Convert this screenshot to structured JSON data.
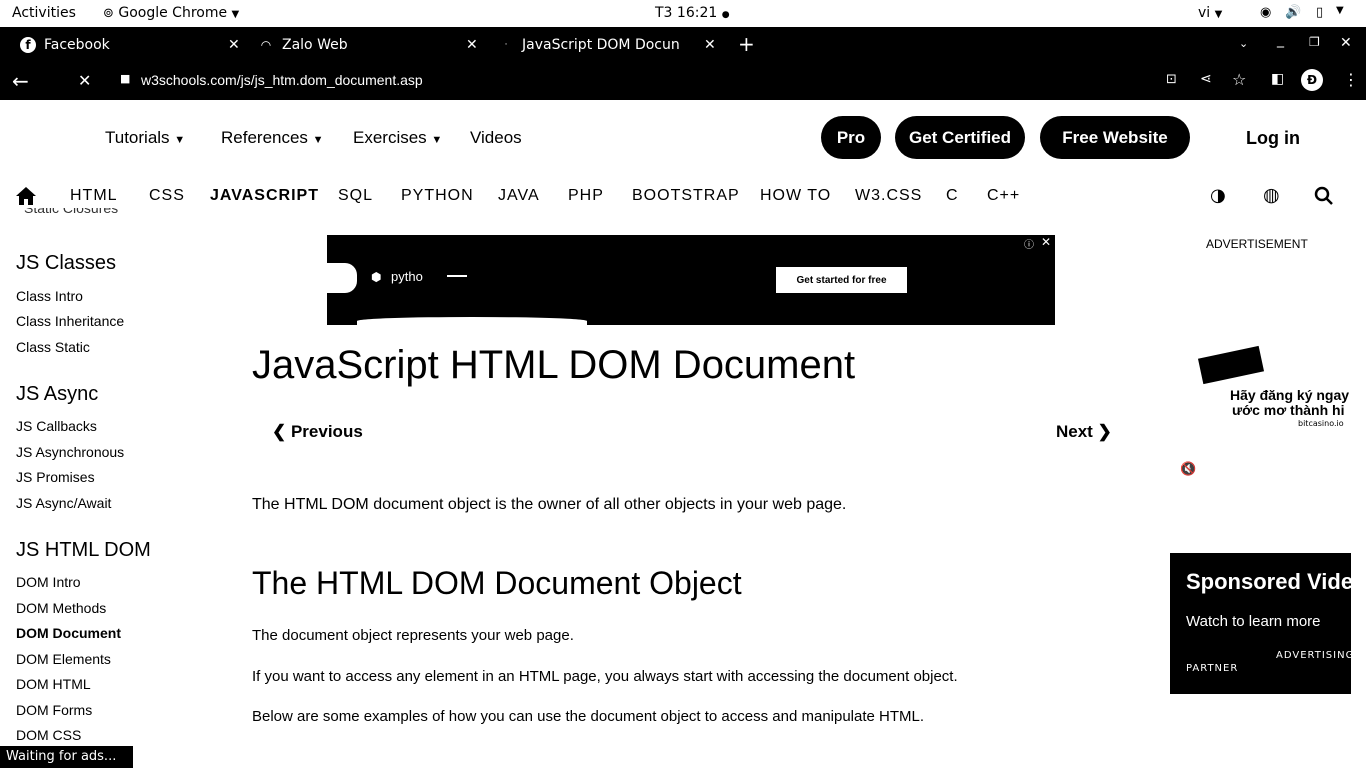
{
  "system_bar": {
    "activities": "Activities",
    "app": "Google Chrome",
    "clock": "T3 16:21",
    "lang": "vi"
  },
  "tabs": [
    {
      "label": "Facebook"
    },
    {
      "label": "Zalo Web"
    },
    {
      "label": "JavaScript DOM Docun"
    }
  ],
  "address": {
    "url": "w3schools.com/js/js_htm.dom_document.asp",
    "profile_initial": "Đ"
  },
  "top_nav": {
    "tutorials": "Tutorials",
    "references": "References",
    "exercises": "Exercises",
    "videos": "Videos",
    "pro": "Pro",
    "certified": "Get Certified",
    "free_website": "Free Website",
    "login": "Log in"
  },
  "sub_nav": [
    "HTML",
    "CSS",
    "JAVASCRIPT",
    "SQL",
    "PYTHON",
    "JAVA",
    "PHP",
    "BOOTSTRAP",
    "HOW TO",
    "W3.CSS",
    "C",
    "C++"
  ],
  "sidebar": {
    "cut_item": "Static Closures",
    "classes_heading": "JS Classes",
    "classes": [
      "Class Intro",
      "Class Inheritance",
      "Class Static"
    ],
    "async_heading": "JS Async",
    "async": [
      "JS Callbacks",
      "JS Asynchronous",
      "JS Promises",
      "JS Async/Await"
    ],
    "dom_heading": "JS HTML DOM",
    "dom": [
      "DOM Intro",
      "DOM Methods",
      "DOM Document",
      "DOM Elements",
      "DOM HTML",
      "DOM Forms",
      "DOM CSS"
    ]
  },
  "ad_banner": {
    "logo_text": "pytho",
    "cta": "Get started for free"
  },
  "main": {
    "title": "JavaScript HTML DOM Document",
    "previous": "❮ Previous",
    "next": "Next ❯",
    "intro": "The HTML DOM document object is the owner of all other objects in your web page.",
    "h2": "The HTML DOM Document Object",
    "p1": "The document object represents your web page.",
    "p2": "If you want to access any element in an HTML page, you always start with accessing the document object.",
    "p3": "Below are some examples of how you can use the document object to access and manipulate HTML."
  },
  "right_ads": {
    "advertisement": "ADVERTISEMENT",
    "ad_line1": "Hãy đăng ký ngay",
    "ad_line2": "ước mơ thành hi",
    "ad_domain": "bitcasino.io",
    "sponsored": "Sponsored Vide",
    "watch": "Watch to learn more",
    "partner": "PARTNER",
    "advertising": "ADVERTISING"
  },
  "status": "Waiting for ads..."
}
